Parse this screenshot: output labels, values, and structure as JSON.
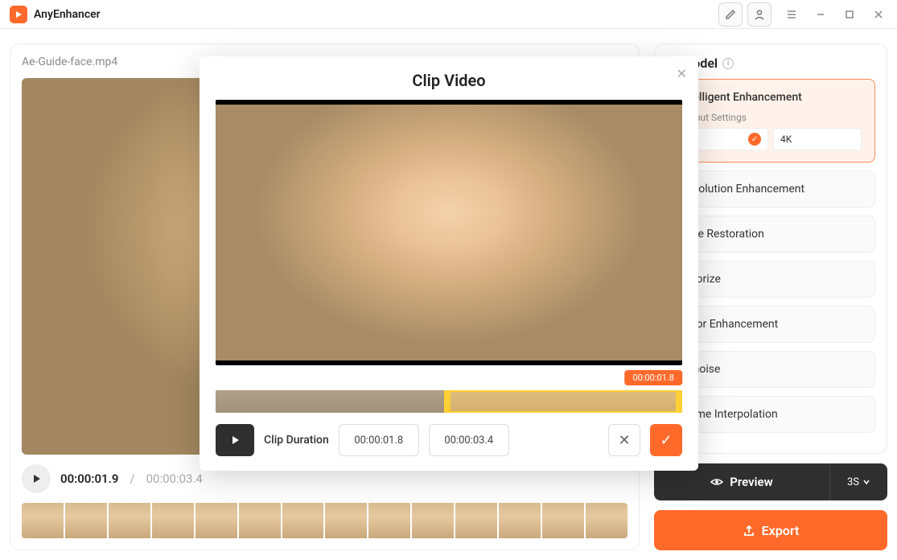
{
  "app": {
    "name": "AnyEnhancer"
  },
  "file": {
    "name": "Ae-Guide-face.mp4"
  },
  "playback": {
    "current": "00:00:01.9",
    "total": "00:00:03.4"
  },
  "sidebar": {
    "title": "AI Model",
    "items": [
      {
        "label": "Intelligent Enhancement",
        "active": true
      },
      {
        "label": "Resolution Enhancement",
        "active": false
      },
      {
        "label": "Face Restoration",
        "active": false
      },
      {
        "label": "Colorize",
        "active": false
      },
      {
        "label": "Color Enhancement",
        "active": false
      },
      {
        "label": "Denoise",
        "active": false
      },
      {
        "label": "Frame Interpolation",
        "active": false
      }
    ],
    "output_settings_label": "Output Settings",
    "output_selected": "4K"
  },
  "actions": {
    "preview_label": "Preview",
    "preview_duration": "3S",
    "export_label": "Export"
  },
  "modal": {
    "title": "Clip Video",
    "position": "00:00:01.8",
    "clip_duration_label": "Clip Duration",
    "start": "00:00:01.8",
    "end": "00:00:03.4"
  }
}
